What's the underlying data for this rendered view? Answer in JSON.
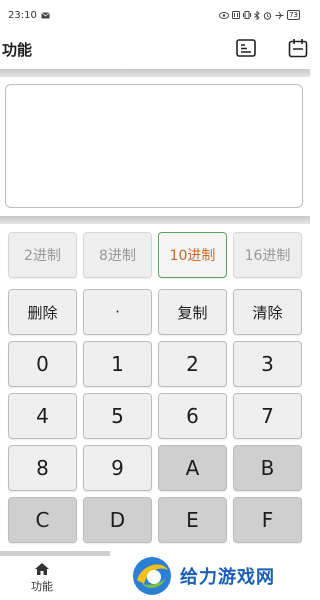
{
  "status_bar": {
    "time": "23:10",
    "battery": "73"
  },
  "header": {
    "title": "功能"
  },
  "input": {
    "value": ""
  },
  "base_buttons": [
    {
      "label": "2进制",
      "active": false
    },
    {
      "label": "8进制",
      "active": false
    },
    {
      "label": "10进制",
      "active": true
    },
    {
      "label": "16进制",
      "active": false
    }
  ],
  "function_buttons": {
    "delete": "删除",
    "dot": "·",
    "copy": "复制",
    "clear": "清除"
  },
  "keys": {
    "k0": "0",
    "k1": "1",
    "k2": "2",
    "k3": "3",
    "k4": "4",
    "k5": "5",
    "k6": "6",
    "k7": "7",
    "k8": "8",
    "k9": "9",
    "kA": "A",
    "kB": "B",
    "kC": "C",
    "kD": "D",
    "kE": "E",
    "kF": "F"
  },
  "tabbar": {
    "home_label": "功能"
  },
  "watermark": {
    "text": "给力游戏网"
  },
  "colors": {
    "active_text": "#c76a2c",
    "active_border": "#5aa45a",
    "hex_key_bg": "#cfcfcf",
    "watermark_blue": "#1a5fb4"
  }
}
